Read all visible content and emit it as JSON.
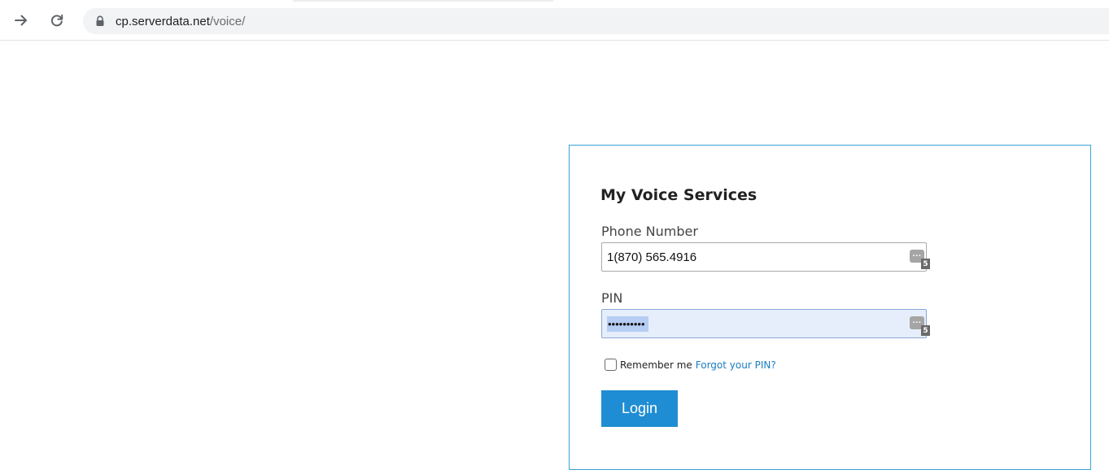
{
  "browser": {
    "url_host": "cp.serverdata.net",
    "url_path": "/voice/"
  },
  "login": {
    "title": "My Voice Services",
    "phone_label": "Phone Number",
    "phone_value": "1(870) 565.4916",
    "pin_label": "PIN",
    "pin_masked": "••••••••••",
    "password_manager_badge": "5",
    "remember_label": "Remember me",
    "forgot_link": "Forgot your PIN?",
    "login_button": "Login"
  },
  "colors": {
    "box_border": "#3aa3d6",
    "button_bg": "#1f8dd3",
    "link": "#1a7ec3"
  }
}
